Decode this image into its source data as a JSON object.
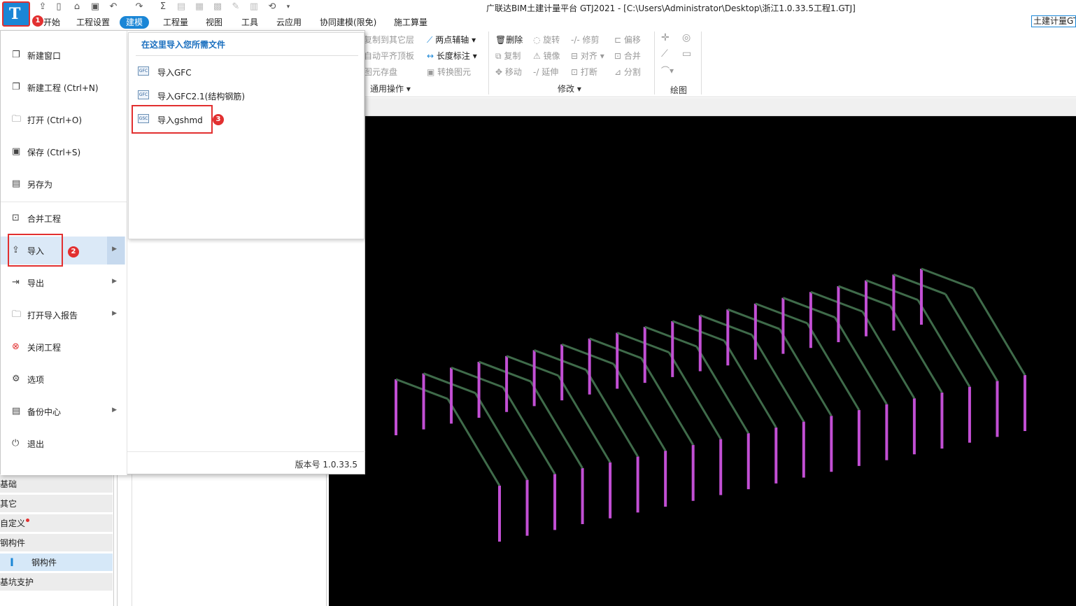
{
  "window": {
    "title": "广联达BIM土建计量平台 GTJ2021 - [C:\\Users\\Administrator\\Desktop\\浙江1.0.33.5工程1.GTJ]",
    "right_tab": "土建计量GTJ"
  },
  "menubar": {
    "items": [
      {
        "label": "开始"
      },
      {
        "label": "工程设置"
      },
      {
        "label": "建模",
        "active": true
      },
      {
        "label": "工程量"
      },
      {
        "label": "视图"
      },
      {
        "label": "工具"
      },
      {
        "label": "云应用"
      },
      {
        "label": "协同建模(限免)"
      },
      {
        "label": "施工算量"
      }
    ]
  },
  "ribbon": {
    "copy_to_floor": "复制到其它层",
    "auto_flat_slab": "自动平齐顶板",
    "save_element": "图元存盘",
    "two_point_axis": "两点辅轴",
    "length_dim": "长度标注",
    "convert_element": "转换图元",
    "general_ops": "通用操作",
    "delete": "删除",
    "rotate": "旋转",
    "trim": "修剪",
    "offset": "偏移",
    "copy": "复制",
    "mirror": "镜像",
    "align": "对齐",
    "merge": "合并",
    "move": "移动",
    "extend": "延伸",
    "break": "打断",
    "split": "分割",
    "modify_group": "修改",
    "draw_group": "绘图"
  },
  "app_menu": {
    "items": [
      {
        "label": "新建窗口",
        "icon": "new-window-icon"
      },
      {
        "label": "新建工程 (Ctrl+N)",
        "icon": "new-project-icon"
      },
      {
        "label": "打开 (Ctrl+O)",
        "icon": "folder-open-icon"
      },
      {
        "label": "保存 (Ctrl+S)",
        "icon": "save-icon"
      },
      {
        "label": "另存为",
        "icon": "save-as-icon"
      },
      {
        "label": "合并工程",
        "icon": "merge-icon"
      },
      {
        "label": "导入",
        "icon": "import-icon",
        "submenu": true,
        "selected": true
      },
      {
        "label": "导出",
        "icon": "export-icon",
        "submenu": true
      },
      {
        "label": "打开导入报告",
        "icon": "folder-report-icon",
        "submenu": true
      },
      {
        "label": "关闭工程",
        "icon": "close-circle-icon"
      },
      {
        "label": "选项",
        "icon": "gear-icon"
      },
      {
        "label": "备份中心",
        "icon": "backup-icon",
        "submenu": true
      },
      {
        "label": "退出",
        "icon": "power-icon"
      }
    ],
    "version": "版本号 1.0.33.5"
  },
  "import_submenu": {
    "header": "在这里导入您所需文件",
    "items": [
      {
        "label": "导入GFC",
        "icon_text": "GFC"
      },
      {
        "label": "导入GFC2.1(结构钢筋)",
        "icon_text": "GFC"
      },
      {
        "label": "导入gshmd",
        "icon_text": "GSC"
      }
    ]
  },
  "left_panel": {
    "categories": [
      {
        "label": "基础"
      },
      {
        "label": "其它"
      },
      {
        "label": "自定义"
      },
      {
        "label": "钢构件"
      },
      {
        "label": "钢构件",
        "selected": true
      },
      {
        "label": "基坑支护"
      }
    ]
  },
  "annotations": [
    "1",
    "2",
    "3"
  ],
  "colors": {
    "accent": "#1a86d6",
    "highlight": "#e23030",
    "column": "#c24fd4",
    "beam": "#3f6b4a",
    "viewport_bg": "#000000"
  }
}
